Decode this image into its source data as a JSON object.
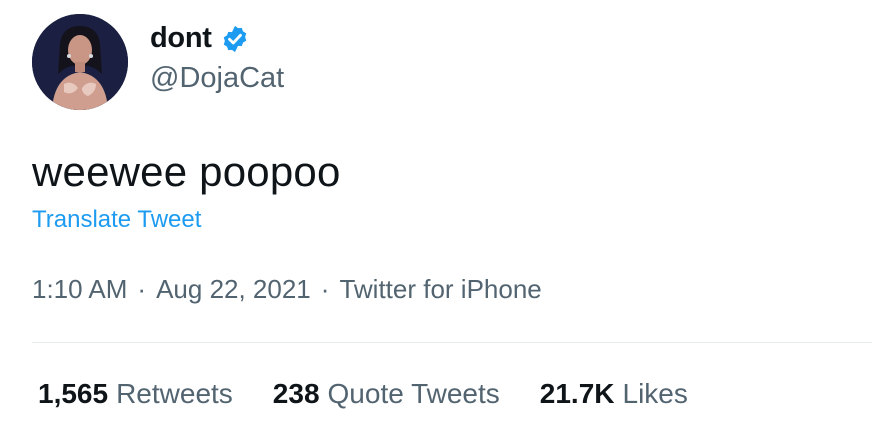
{
  "tweet": {
    "display_name": "dont",
    "handle": "@DojaCat",
    "text": "weewee poopoo",
    "translate_label": "Translate Tweet",
    "time": "1:10 AM",
    "date": "Aug 22, 2021",
    "source": "Twitter for iPhone",
    "separator": "·"
  },
  "stats": [
    {
      "count": "1,565",
      "label": "Retweets"
    },
    {
      "count": "238",
      "label": "Quote Tweets"
    },
    {
      "count": "21.7K",
      "label": "Likes"
    }
  ],
  "icons": {
    "verified": "verified-badge-icon",
    "avatar": "profile-photo"
  },
  "colors": {
    "link": "#1d9bf0",
    "secondary_text": "#536471",
    "primary_text": "#0f1419",
    "verified": "#1d9bf0"
  }
}
